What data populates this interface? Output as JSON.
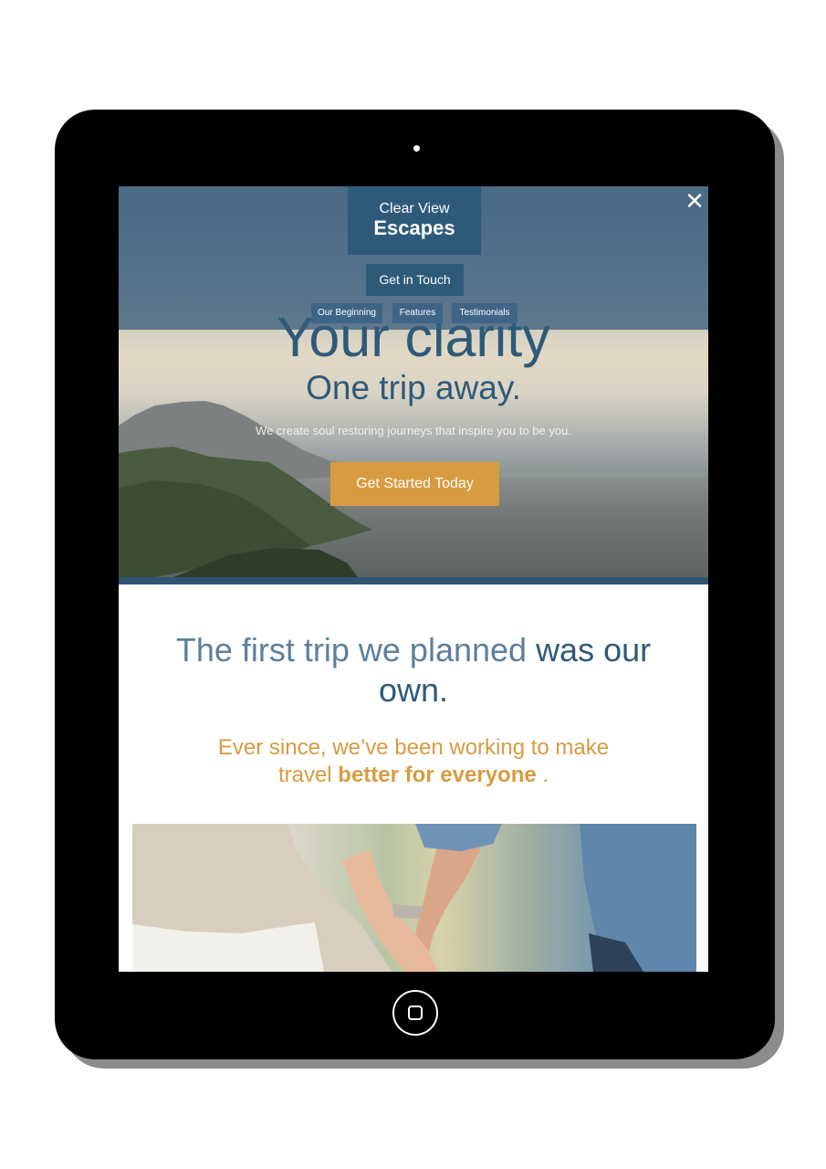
{
  "brand": {
    "line1": "Clear View",
    "line2": "Escapes"
  },
  "header": {
    "close_icon": "close-icon",
    "contact_button": "Get in Touch",
    "nav": [
      "Our Beginning",
      "Features",
      "Testimonials"
    ]
  },
  "hero": {
    "title": "Your clarity",
    "subtitle": "One trip away.",
    "text": "We create soul restoring journeys that inspire you to be you.",
    "cta": "Get Started Today"
  },
  "story": {
    "title_light": "The first trip we planned ",
    "title_bold": "was our own.",
    "sub_light": "Ever since, we’ve been working to make travel ",
    "sub_bold": "better for everyone",
    "sub_end": " ."
  },
  "colors": {
    "primary": "#2e5a7a",
    "accent": "#d89b40",
    "device": "#000000"
  }
}
